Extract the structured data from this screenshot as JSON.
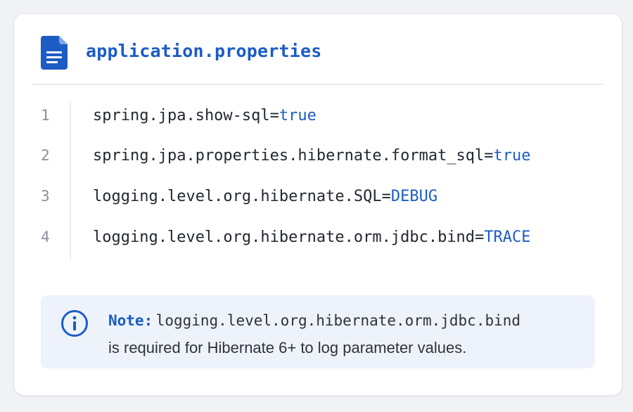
{
  "file": {
    "name": "application.properties",
    "icon": "document-icon"
  },
  "code_lines": [
    {
      "number": "1",
      "key": "spring.jpa.show-sql",
      "equals": "=",
      "value": "true"
    },
    {
      "number": "2",
      "key": "spring.jpa.properties.hibernate.format_sql",
      "equals": "=",
      "value": "true"
    },
    {
      "number": "3",
      "key": "logging.level.org.hibernate.SQL",
      "equals": "=",
      "value": "DEBUG"
    },
    {
      "number": "4",
      "key": "logging.level.org.hibernate.orm.jdbc.bind",
      "equals": "=",
      "value": "TRACE"
    }
  ],
  "note": {
    "icon": "info-icon",
    "label": "Note:",
    "code": "logging.level.org.hibernate.orm.jdbc.bind",
    "text": "is required for Hibernate 6+ to log parameter values."
  },
  "colors": {
    "accent": "#1c5cc4",
    "note_background": "#eef3fb",
    "card_background": "#ffffff",
    "page_background": "#f1f2f5"
  }
}
